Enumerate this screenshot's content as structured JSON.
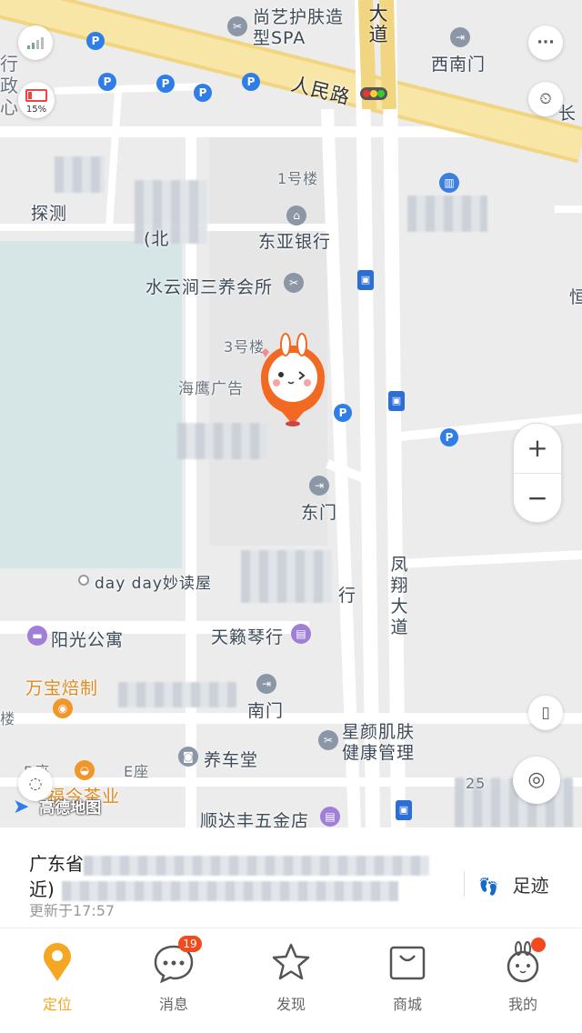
{
  "map": {
    "road_labels": {
      "renmin_road": "人民路",
      "top_da_dao": "大道",
      "fengxiang_da_dao": "凤翔大道"
    },
    "labels": {
      "spa": "尚艺护肤造型SPA",
      "west_gate": "西南门",
      "chang": "长",
      "xingzheng": "行政心",
      "tancece": "探测",
      "bei": "(北",
      "building_1": "1号楼",
      "dongya_bank": "东亚银行",
      "shuiyunjian": "水云涧三养会所",
      "building_3": "3号楼",
      "haiying": "海鹰广告",
      "east_gate": "东门",
      "dayday": "day day妙读屋",
      "hang": "行",
      "yangguang": "阳光公寓",
      "tianlai": "天籁琴行",
      "wanbao": "万宝焙制",
      "south_gate": "南门",
      "lou": "楼",
      "xingyan": "星颜肌肤健康管理",
      "yangche": "养车堂",
      "e_zuo": "E座",
      "b_zuo": "B座",
      "fujin_tea": "福今茶业",
      "shunda": "顺达丰五金店",
      "num_25": "25",
      "heng": "恒",
      "gaode": "高德地图"
    },
    "battery_percent": "15%",
    "zoom_in": "+",
    "zoom_out": "−",
    "more": "···"
  },
  "panel": {
    "address_start": "广东省",
    "address_end": "近)",
    "updated": "更新于17:57",
    "footprint_label": "足迹"
  },
  "tabs": [
    {
      "label": "定位",
      "badge": ""
    },
    {
      "label": "消息",
      "badge": "19"
    },
    {
      "label": "发现",
      "badge": ""
    },
    {
      "label": "商城",
      "badge": ""
    },
    {
      "label": "我的",
      "badge": ""
    }
  ],
  "colors": {
    "accent": "#f5a623",
    "badge": "#f04a1e",
    "parking": "#2f7ee8",
    "road_major": "#f7e6a5",
    "water": "#d6e6e6"
  }
}
